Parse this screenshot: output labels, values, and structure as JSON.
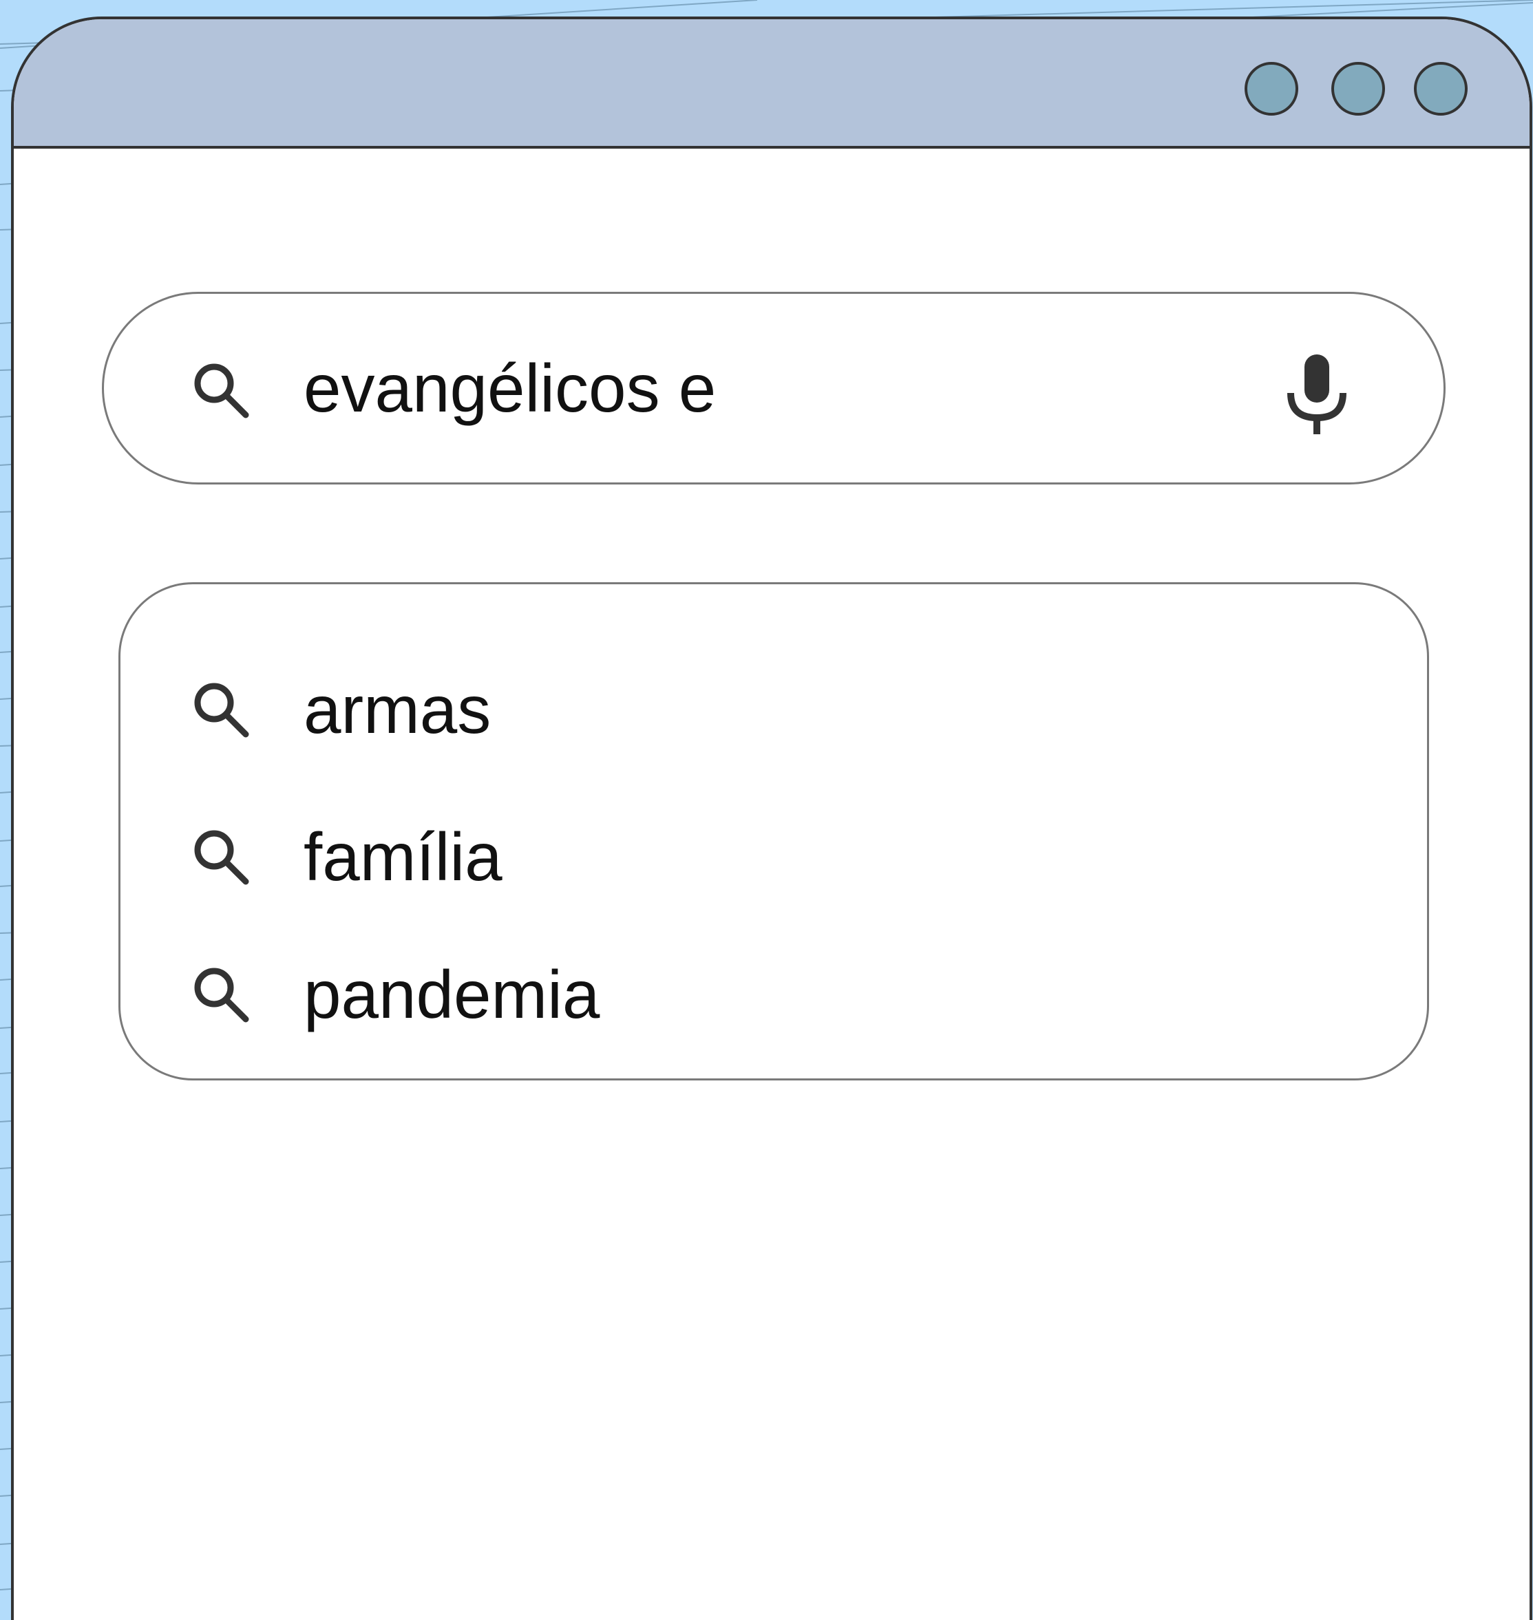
{
  "search": {
    "query": "evangélicos e",
    "icon": "search-icon",
    "voice_icon": "microphone-icon"
  },
  "window_controls": [
    {
      "name": "window-control-1"
    },
    {
      "name": "window-control-2"
    },
    {
      "name": "window-control-3"
    }
  ],
  "suggestions": [
    {
      "label": "armas",
      "icon": "search-icon"
    },
    {
      "label": "família",
      "icon": "search-icon"
    },
    {
      "label": "pandemia",
      "icon": "search-icon"
    }
  ],
  "colors": {
    "background": "#b3dcfb",
    "titlebar": "#b3c3da",
    "window_control": "#82aabd",
    "outline": "#333333"
  }
}
